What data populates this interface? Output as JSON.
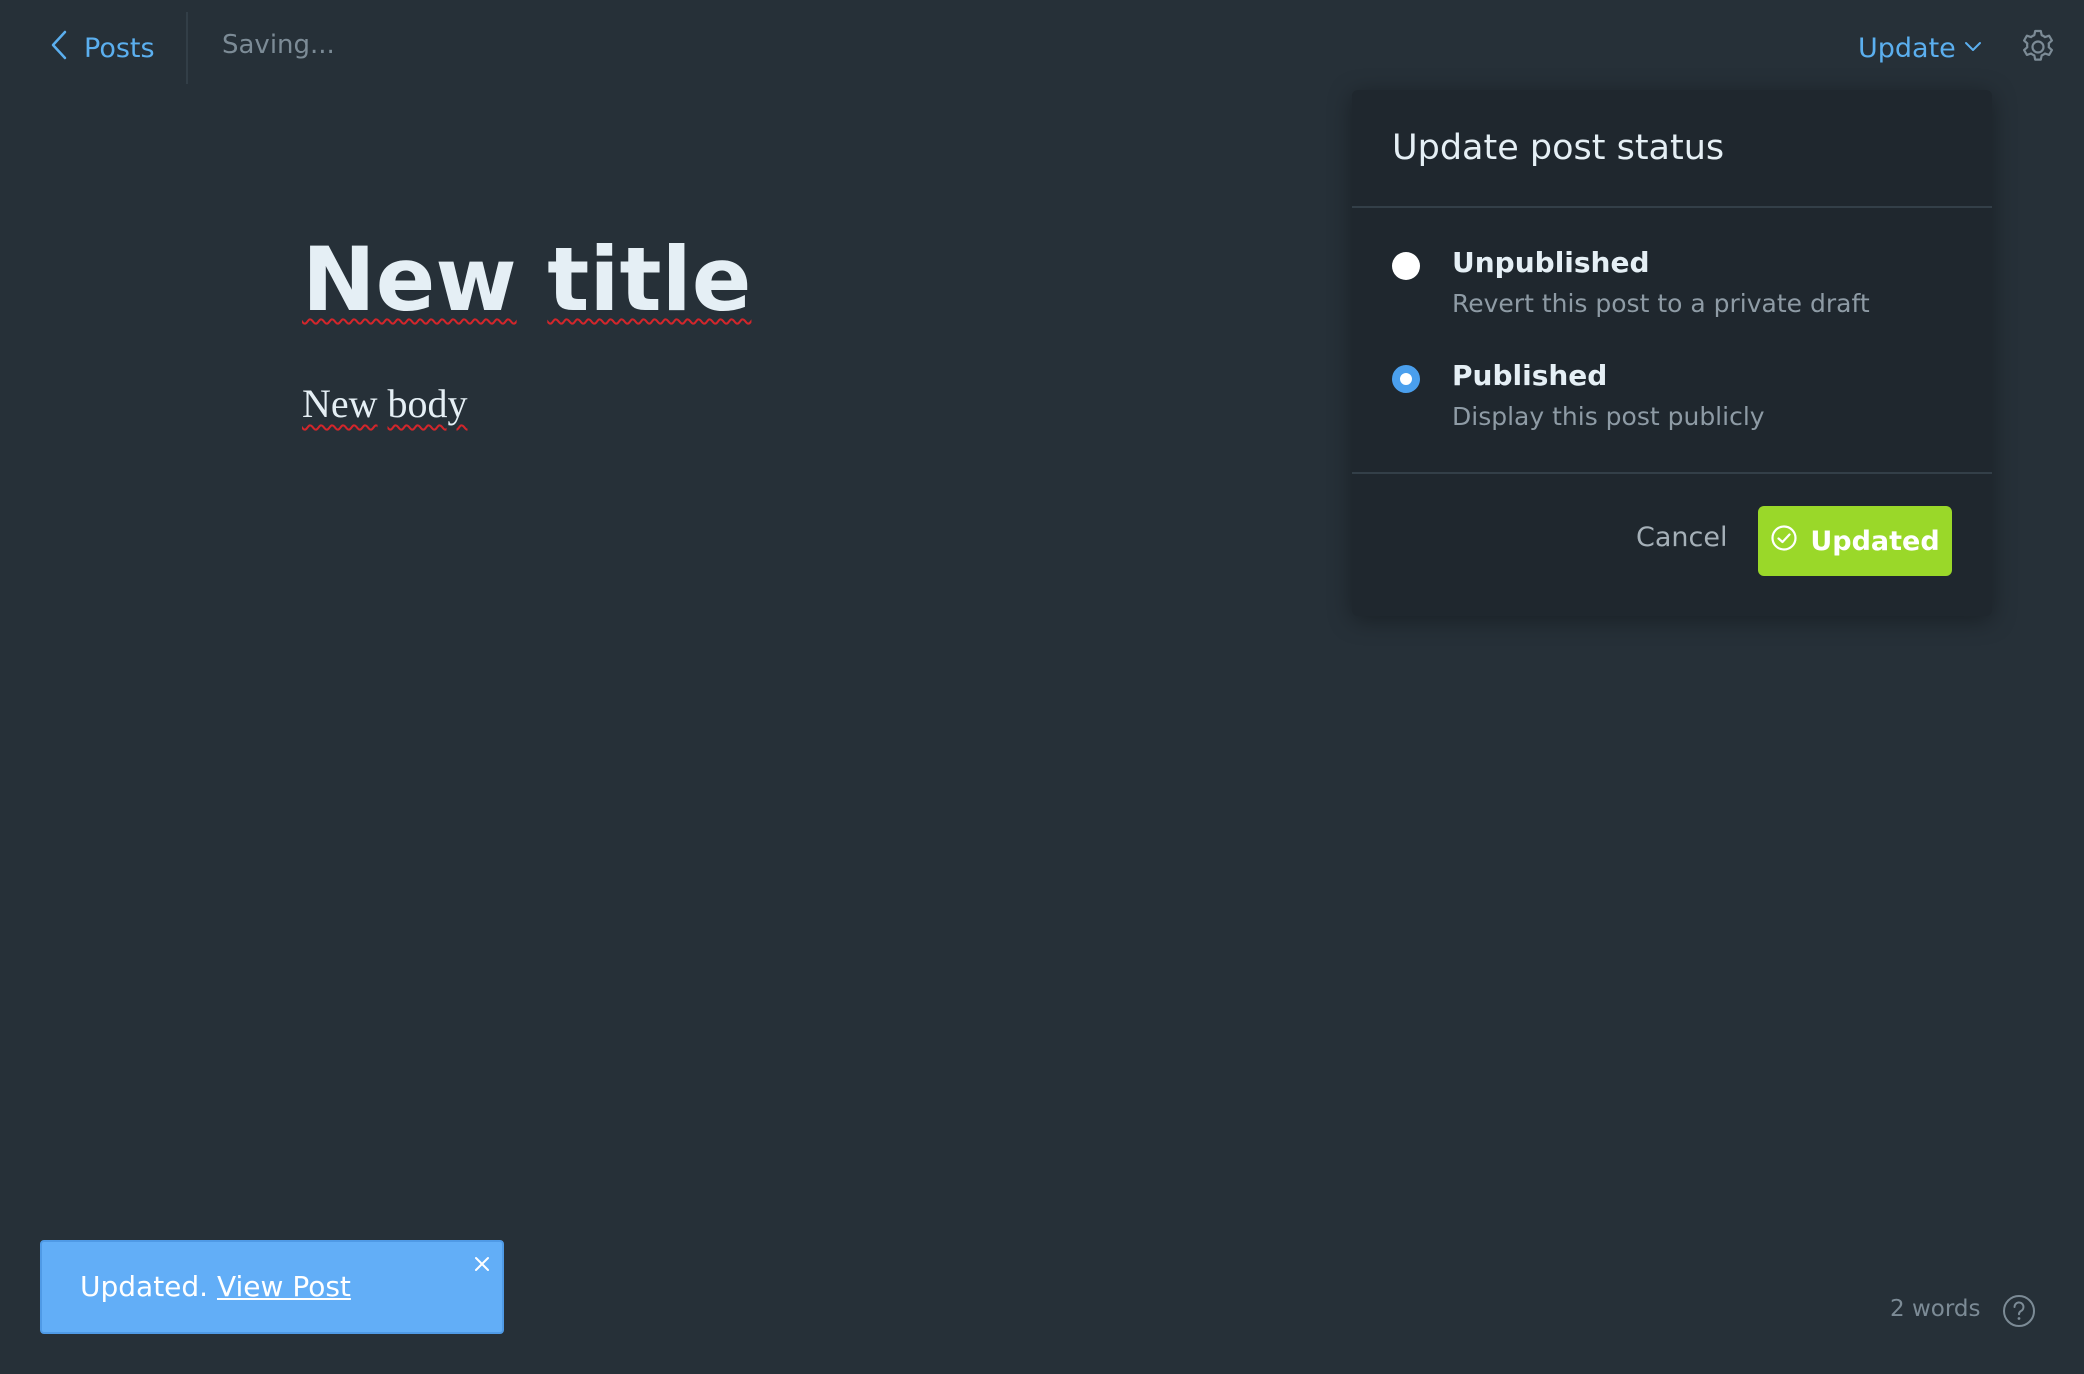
{
  "header": {
    "back_label": "Posts",
    "save_status": "Saving...",
    "update_label": "Update"
  },
  "editor": {
    "title_words": [
      "New",
      "title"
    ],
    "body_words": [
      "New",
      "body"
    ]
  },
  "popover": {
    "title": "Update post status",
    "options": [
      {
        "label": "Unpublished",
        "description": "Revert this post to a private draft",
        "selected": false
      },
      {
        "label": "Published",
        "description": "Display this post publicly",
        "selected": true
      }
    ],
    "cancel_label": "Cancel",
    "confirm_label": "Updated"
  },
  "toast": {
    "message": "Updated.",
    "link_label": "View Post"
  },
  "footer": {
    "word_count": "2 words"
  },
  "colors": {
    "background": "#263038",
    "accent_blue": "#5bafef",
    "success_green": "#9ad829",
    "toast_blue": "#62aef7",
    "spellcheck_red": "#d3262b"
  },
  "icons": {
    "back": "chevron-left-icon",
    "update_dropdown": "chevron-down-icon",
    "settings": "gear-icon",
    "confirm": "check-circle-icon",
    "toast_close": "close-icon",
    "help": "question-circle-icon"
  }
}
